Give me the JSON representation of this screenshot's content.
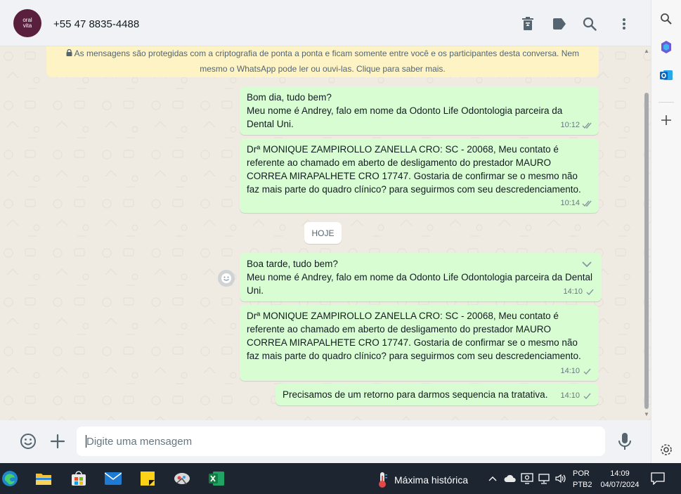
{
  "header": {
    "avatar_text": "oral\nvita",
    "contact_name": "+55 47 8835-4488"
  },
  "encryption_notice": "As mensagens são protegidas com a criptografia de ponta a ponta e ficam somente entre você e os participantes desta conversa. Nem mesmo o WhatsApp pode ler ou ouvi-las. Clique para saber mais.",
  "messages": [
    {
      "text": "Bom dia, tudo bem?\nMeu nome é Andrey, falo em nome da Odonto Life Odontologia parceira da Dental Uni.",
      "time": "10:12",
      "status": "double-check"
    },
    {
      "text": "Drª MONIQUE ZAMPIROLLO ZANELLA CRO: SC - 20068, Meu contato é referente ao chamado em aberto de desligamento do prestador MAURO CORREA MIRAPALHETE  CRO 17747. Gostaria de confirmar se o mesmo não faz mais parte do quadro clínico? para seguirmos com seu descredenciamento.",
      "time": "10:14",
      "status": "double-check"
    },
    {
      "text": "Boa tarde, tudo bem?\nMeu nome é Andrey, falo em nome da Odonto Life Odontologia parceira da Dental Uni.",
      "time": "14:10",
      "status": "single-check"
    },
    {
      "text": "Drª MONIQUE ZAMPIROLLO ZANELLA CRO: SC - 20068, Meu contato é referente ao chamado em aberto de desligamento do prestador MAURO CORREA MIRAPALHETE  CRO 17747. Gostaria de confirmar se o mesmo não faz mais parte do quadro clínico? para seguirmos com seu descredenciamento.",
      "time": "14:10",
      "status": "single-check"
    },
    {
      "text": "Precisamos de um retorno para darmos sequencia na tratativa.",
      "time": "14:10",
      "status": "single-check"
    }
  ],
  "date_chip": "HOJE",
  "composer": {
    "placeholder": "Digite uma mensagem"
  },
  "taskbar": {
    "weather_text": "Máxima histórica",
    "lang_line1": "POR",
    "lang_line2": "PTB2",
    "time": "14:09",
    "date": "04/07/2024"
  },
  "colors": {
    "outgoing_bubble": "#d9fdd3",
    "chat_bg": "#efeae2",
    "notice_bg": "#fdf3c5",
    "header_bg": "#f0f2f5",
    "taskbar_bg": "#1c2530"
  },
  "icons": {
    "header": [
      "trash-icon",
      "label-icon",
      "search-icon",
      "menu-dots-icon"
    ],
    "sidebar": [
      "search-icon",
      "copilot-icon",
      "outlook-icon",
      "plus-icon",
      "settings-icon"
    ],
    "taskbar": [
      "edge-icon",
      "file-explorer-icon",
      "store-icon",
      "mail-icon",
      "sticky-notes-icon",
      "snipping-icon",
      "excel-icon"
    ]
  }
}
